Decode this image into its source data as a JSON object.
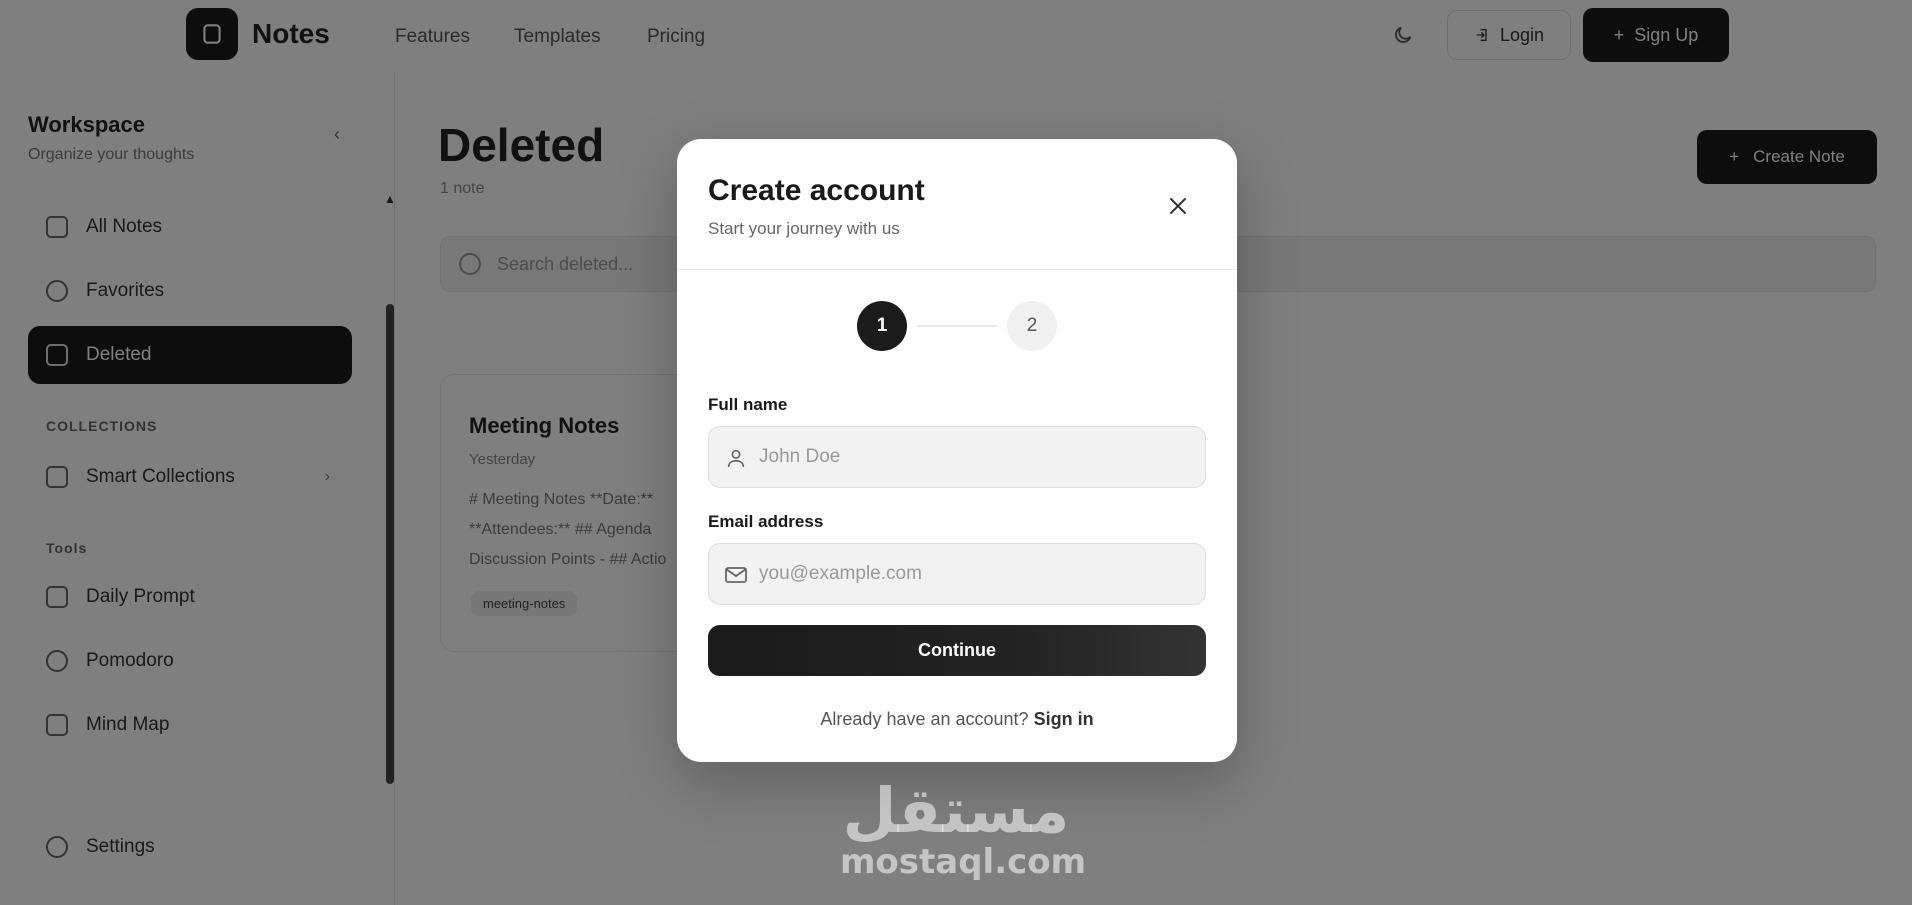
{
  "nav": {
    "brand": "Notes",
    "links": [
      "Features",
      "Templates",
      "Pricing"
    ],
    "login_label": "Login",
    "signup_label": "Sign Up"
  },
  "sidebar": {
    "workspace_title": "Workspace",
    "workspace_subtitle": "Organize your thoughts",
    "items": [
      {
        "label": "All Notes",
        "icon": "notes-icon"
      },
      {
        "label": "Favorites",
        "icon": "star-icon"
      },
      {
        "label": "Deleted",
        "icon": "trash-icon",
        "active": true
      }
    ],
    "collections_heading": "COLLECTIONS",
    "smart_collections_label": "Smart Collections",
    "tools_heading": "Tools",
    "tools": [
      {
        "label": "Daily Prompt",
        "icon": "calendar-icon"
      },
      {
        "label": "Pomodoro",
        "icon": "timer-icon"
      },
      {
        "label": "Mind Map",
        "icon": "map-icon"
      }
    ],
    "settings_label": "Settings"
  },
  "main": {
    "title": "Deleted",
    "count": "1 note",
    "create_note_label": "Create Note",
    "search_placeholder": "Search deleted...",
    "note": {
      "title": "Meeting Notes",
      "meta": "Yesterday",
      "lines": [
        "# Meeting Notes **Date:** ",
        "**Attendees:** ## Agenda",
        "Discussion Points - ## Actio"
      ],
      "tag": "meeting-notes"
    }
  },
  "modal": {
    "title": "Create account",
    "subtitle": "Start your journey with us",
    "steps": [
      "1",
      "2"
    ],
    "full_name_label": "Full name",
    "full_name_placeholder": "John Doe",
    "email_label": "Email address",
    "email_placeholder": "you@example.com",
    "continue_label": "Continue",
    "signin_prompt": "Already have an account?",
    "signin_link": "Sign in"
  },
  "watermark": {
    "arabic": "مستقل",
    "latin": "mostaql.com"
  },
  "colors": {
    "primary": "#1b1b1b",
    "overlay": "rgba(0,0,0,0.5)",
    "input_bg": "#f2f2f2"
  }
}
